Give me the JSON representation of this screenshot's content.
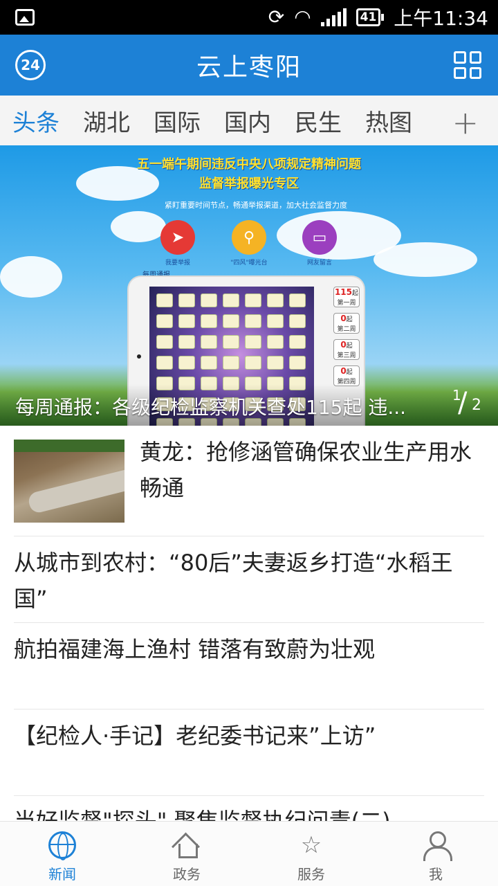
{
  "status_bar": {
    "time": "上午11:34",
    "battery": "41",
    "icons": [
      "gallery-icon",
      "sync-icon",
      "wifi-icon",
      "signal-icon",
      "battery-icon"
    ]
  },
  "header": {
    "title": "云上枣阳",
    "badge": "24",
    "icons": [
      "24h-badge-icon",
      "grid-menu-icon"
    ],
    "color": "#1d81d6"
  },
  "tabs": [
    {
      "label": "头条",
      "active": true
    },
    {
      "label": "湖北",
      "active": false
    },
    {
      "label": "国际",
      "active": false
    },
    {
      "label": "国内",
      "active": false
    },
    {
      "label": "民生",
      "active": false
    },
    {
      "label": "热图",
      "active": false
    }
  ],
  "tab_add": "+",
  "banner": {
    "headline_line1": "五一端午期间违反中央八项规定精神问题",
    "headline_line2": "监督举报曝光专区",
    "subline": "紧盯重要时间节点，畅通举报渠道，加大社会监督力度",
    "buttons": [
      {
        "label": "我要举报",
        "icon": "paper-plane-icon",
        "color": "#e53935"
      },
      {
        "label": "\"四风\"曝光台",
        "icon": "magnifier-icon",
        "color": "#f5b324"
      },
      {
        "label": "网友留言",
        "icon": "message-icon",
        "color": "#9b3fbf"
      }
    ],
    "week_label": "每周通报",
    "side_cards": [
      {
        "count": "115",
        "unit": "起",
        "week": "第一周"
      },
      {
        "count": "0",
        "unit": "起",
        "week": "第二周"
      },
      {
        "count": "0",
        "unit": "起",
        "week": "第三周"
      },
      {
        "count": "0",
        "unit": "起",
        "week": "第四周"
      }
    ],
    "caption": "每周通报：各级纪检监察机关查处115起 违...",
    "page_current": "1",
    "page_total": "2"
  },
  "news": [
    {
      "title": "黄龙：抢修涵管确保农业生产用水畅通",
      "has_image": true
    },
    {
      "title": "从城市到农村：“80后”夫妻返乡打造“水稻王国”",
      "has_image": false
    },
    {
      "title": "航拍福建海上渔村 错落有致蔚为壮观",
      "has_image": false
    },
    {
      "title": "【纪检人·手记】老纪委书记来”上访”",
      "has_image": false
    },
    {
      "title": "当好监督\"探头\" 聚焦监督执纪问责(二)",
      "has_image": false
    }
  ],
  "bottom_nav": [
    {
      "label": "新闻",
      "icon": "globe-icon",
      "active": true
    },
    {
      "label": "政务",
      "icon": "house-icon",
      "active": false
    },
    {
      "label": "服务",
      "icon": "star-service-icon",
      "active": false
    },
    {
      "label": "我",
      "icon": "user-icon",
      "active": false
    }
  ]
}
